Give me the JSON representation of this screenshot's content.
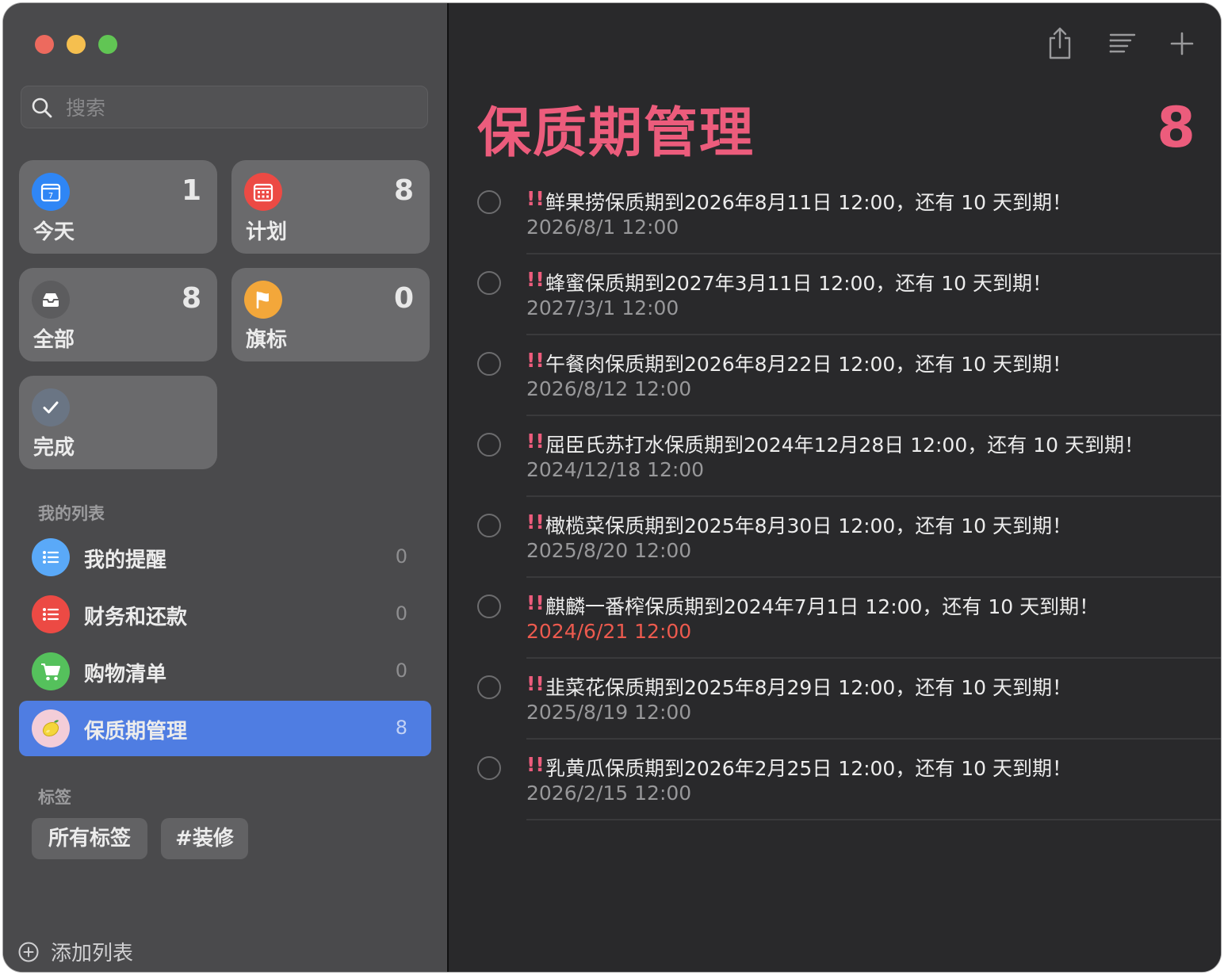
{
  "colors": {
    "accent": "#ec5c7c",
    "selection": "#4f7de2",
    "overdue": "#ec5a4e",
    "close": "#ed6a5e",
    "minimize": "#f5bf4f",
    "zoom": "#61c554"
  },
  "search": {
    "placeholder": "搜索",
    "icon": "search-icon"
  },
  "smart_lists": [
    {
      "label": "今天",
      "count": "1",
      "icon": "calendar-icon",
      "color": "#2f86f5"
    },
    {
      "label": "计划",
      "count": "8",
      "icon": "calendar-grid-icon",
      "color": "#ec4a44"
    },
    {
      "label": "全部",
      "count": "8",
      "icon": "tray-icon",
      "color": "#5c5c5e"
    },
    {
      "label": "旗标",
      "count": "0",
      "icon": "flag-icon",
      "color": "#f3a73a"
    },
    {
      "label": "完成",
      "icon": "checkmark-icon",
      "color": "#6a7584"
    }
  ],
  "my_lists": {
    "header": "我的列表",
    "items": [
      {
        "label": "我的提醒",
        "count": "0",
        "icon": "list-bullet-icon",
        "color": "#5aa9f8"
      },
      {
        "label": "财务和还款",
        "count": "0",
        "icon": "list-bullet-icon",
        "color": "#ec4a44"
      },
      {
        "label": "购物清单",
        "count": "0",
        "icon": "cart-icon",
        "color": "#55c15c"
      },
      {
        "label": "保质期管理",
        "count": "8",
        "icon": "lemon-icon",
        "color": "#f3cdd8",
        "selected": true
      }
    ]
  },
  "tags": {
    "header": "标签",
    "items": [
      "所有标签",
      "#装修"
    ]
  },
  "add_list": {
    "label": "添加列表",
    "icon": "plus-circle-icon"
  },
  "toolbar": {
    "share": "share-icon",
    "list_view": "list-view-icon",
    "add": "plus-icon"
  },
  "main": {
    "title": "保质期管理",
    "count": "8",
    "reminders": [
      {
        "priority": "!!",
        "title": "鲜果捞保质期到2026年8月11日 12:00，还有 10 天到期！",
        "date": "2026/8/1 12:00",
        "overdue": false
      },
      {
        "priority": "!!",
        "title": "蜂蜜保质期到2027年3月11日 12:00，还有 10 天到期！",
        "date": "2027/3/1 12:00",
        "overdue": false
      },
      {
        "priority": "!!",
        "title": "午餐肉保质期到2026年8月22日 12:00，还有 10 天到期！",
        "date": "2026/8/12 12:00",
        "overdue": false
      },
      {
        "priority": "!!",
        "title": "屈臣氏苏打水保质期到2024年12月28日 12:00，还有 10 天到期！",
        "date": "2024/12/18 12:00",
        "overdue": false
      },
      {
        "priority": "!!",
        "title": "橄榄菜保质期到2025年8月30日 12:00，还有 10 天到期！",
        "date": "2025/8/20 12:00",
        "overdue": false
      },
      {
        "priority": "!!",
        "title": "麒麟一番榨保质期到2024年7月1日 12:00，还有 10 天到期！",
        "date": "2024/6/21 12:00",
        "overdue": true
      },
      {
        "priority": "!!",
        "title": "韭菜花保质期到2025年8月29日 12:00，还有 10 天到期！",
        "date": "2025/8/19 12:00",
        "overdue": false
      },
      {
        "priority": "!!",
        "title": "乳黄瓜保质期到2026年2月25日 12:00，还有 10 天到期！",
        "date": "2026/2/15 12:00",
        "overdue": false
      }
    ]
  }
}
